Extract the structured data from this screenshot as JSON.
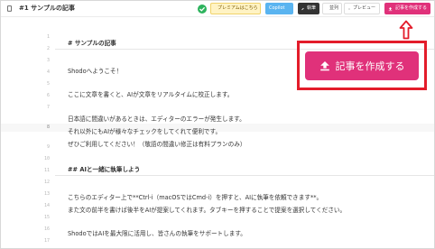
{
  "header": {
    "title": "#1 サンプルの記事",
    "premium_label": "プレミアムはこちら",
    "copilot_label": "Copilot",
    "edit_label": "執筆",
    "side_label": "並列",
    "preview_label": "プレビュー",
    "create_label": "記事を作成する"
  },
  "main": {
    "create_button_label": "記事を作成する"
  },
  "editor": {
    "gutter": [
      "1",
      "2",
      "3",
      "4",
      "5",
      "6",
      "7",
      "8",
      "9",
      "10",
      "11",
      "12",
      "13",
      "14",
      "15",
      "16",
      "17",
      "18",
      "19"
    ],
    "lines": [
      "# サンプルの記事",
      "Shodoへようこそ！",
      "ここに文章を書くと、AIが文章をリアルタイムに校正します。",
      "日本語に間違いがあるときは、エディターのエラーが発生します。",
      "それ以外にもAIが様々なチェックをしてくれて便利です。",
      "ぜひご利用してください！（敬語の間違い修正は有料プランのみ）",
      "## AIと一緒に執筆しよう",
      "こちらのエディター上で**Ctrl-i（macOSではCmd-i）を押すと、AIに執筆を依頼できます**。",
      "また文の前半を書けば後半をAIが提案してくれます。タブキーを押することで提案を選択してください。",
      "ShodoではAIを最大限に活用し、皆さんの執筆をサポートします。"
    ]
  },
  "colors": {
    "accent": "#e0317a",
    "annotation": "#e31c2a",
    "copilot": "#5ab4f0",
    "premium": "#fff3c4",
    "ok": "#2db35d"
  },
  "icons": [
    "back-icon",
    "check-icon",
    "star-icon",
    "pen-icon",
    "columns-icon",
    "eye-icon",
    "upload-icon",
    "arrow-up-icon"
  ]
}
